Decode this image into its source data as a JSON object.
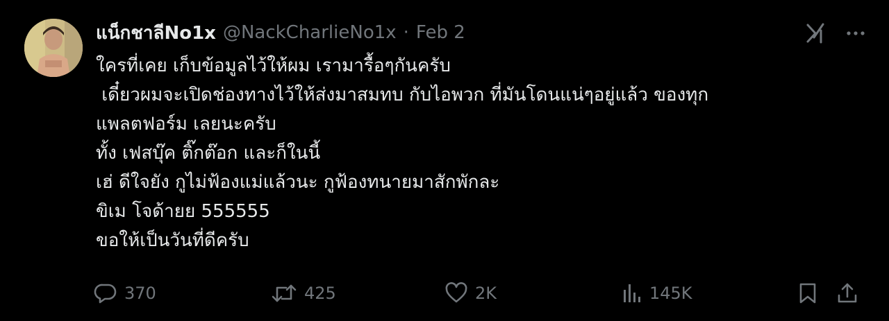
{
  "tweet": {
    "author": {
      "display_name": "แน็กชาลีNo1x",
      "handle": "@NackCharlieNo1x",
      "separator": "·",
      "date": "Feb 2"
    },
    "lines": [
      "ใครที่เคย เก็บข้อมูลไว้ให้ผม เรามารื้อๆกันครับ",
      " เดี๋ยวผมจะเปิดช่องทางไว้ให้ส่งมาสมทบ กับไอพวก ที่มันโดนแน่ๆอยู่แล้ว ของทุก",
      "แพลตฟอร์ม เลยนะครับ",
      "ทั้ง เฟสบุ๊ค ติ๊กต๊อก และก็ในนี้",
      "เฮ่ ดีใจยัง กูไม่ฟ้องแม่แล้วนะ กูฟ้องทนายมาสักพักละ",
      "ขิเม โจด้ายย 555555",
      "ขอให้เป็นวันที่ดีครับ"
    ],
    "stats": {
      "replies": "370",
      "retweets": "425",
      "likes": "2K",
      "views": "145K"
    },
    "icons": {
      "reply": "reply-icon",
      "retweet": "retweet-icon",
      "like": "heart-icon",
      "views": "views-chart-icon",
      "bookmark": "bookmark-icon",
      "share": "share-icon",
      "grok": "grok-icon",
      "more": "more-icon"
    },
    "colors": {
      "background": "#000000",
      "text": "#e7e9ea",
      "muted": "#71767b"
    }
  }
}
